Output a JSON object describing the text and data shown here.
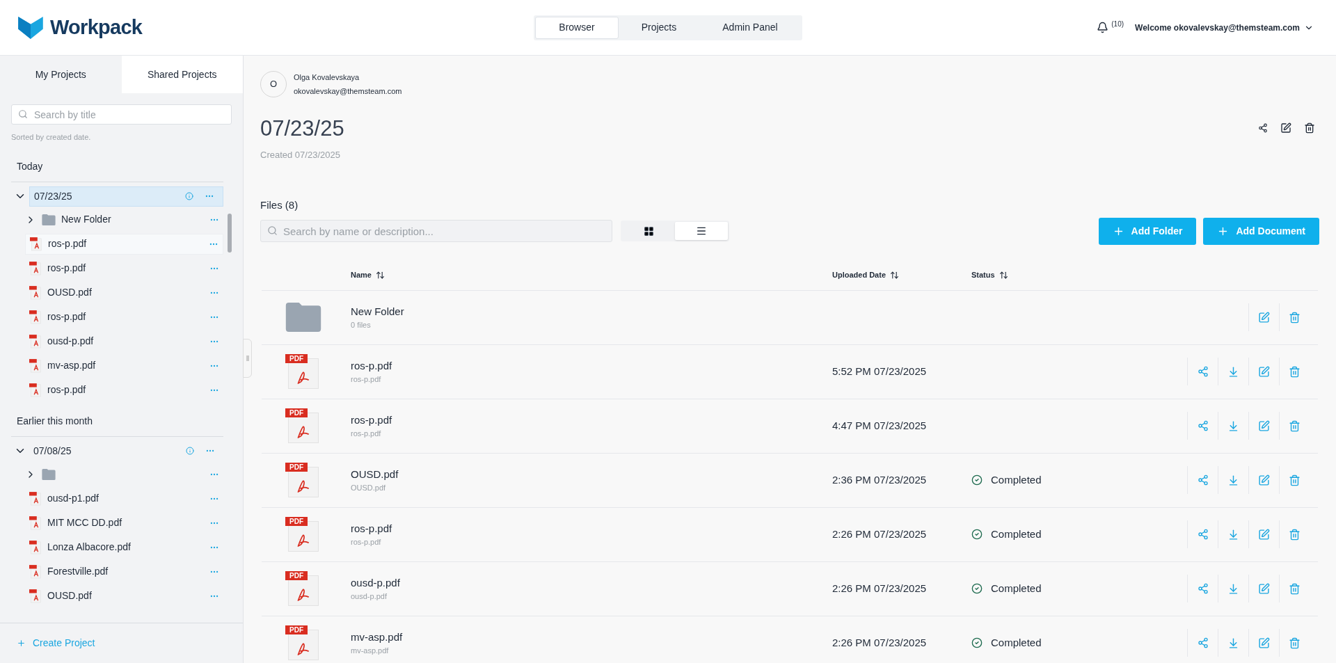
{
  "header": {
    "logo": "Workpack",
    "nav": [
      {
        "label": "Browser",
        "selected": true
      },
      {
        "label": "Projects",
        "selected": false
      },
      {
        "label": "Admin Panel",
        "selected": false
      }
    ],
    "notification_count": "(10)",
    "welcome": "Welcome okovalevskay@themsteam.com"
  },
  "sidebar": {
    "tabs": [
      {
        "label": "My Projects",
        "selected": false
      },
      {
        "label": "Shared Projects",
        "selected": true
      }
    ],
    "search": {
      "placeholder": "Search by title"
    },
    "sort_note": "Sorted by created date.",
    "sections": [
      {
        "label": "Today",
        "projects": [
          {
            "name": "07/23/25",
            "selected": true,
            "expanded": true,
            "children": [
              {
                "kind": "folder",
                "name": "New Folder",
                "expanded": false,
                "hovered": false
              },
              {
                "kind": "file",
                "name": "ros-p.pdf",
                "hovered": true
              },
              {
                "kind": "file",
                "name": "ros-p.pdf",
                "hovered": false
              },
              {
                "kind": "file",
                "name": "OUSD.pdf",
                "hovered": false
              },
              {
                "kind": "file",
                "name": "ros-p.pdf",
                "hovered": false
              },
              {
                "kind": "file",
                "name": "ousd-p.pdf",
                "hovered": false
              },
              {
                "kind": "file",
                "name": "mv-asp.pdf",
                "hovered": false
              },
              {
                "kind": "file",
                "name": "ros-p.pdf",
                "hovered": false
              }
            ]
          }
        ]
      },
      {
        "label": "Earlier this month",
        "projects": [
          {
            "name": "07/08/25",
            "selected": false,
            "expanded": true,
            "children": [
              {
                "kind": "folder",
                "expanded": false,
                "hovered": false
              },
              {
                "kind": "file",
                "name": "ousd-p1.pdf",
                "hovered": false
              },
              {
                "kind": "file",
                "name": "MIT MCC DD.pdf",
                "hovered": false
              },
              {
                "kind": "file",
                "name": "Lonza Albacore.pdf",
                "hovered": false
              },
              {
                "kind": "file",
                "name": "Forestville.pdf",
                "hovered": false
              },
              {
                "kind": "file",
                "name": "OUSD.pdf",
                "hovered": false
              }
            ]
          }
        ]
      }
    ],
    "create_project": "Create Project"
  },
  "main": {
    "owner": {
      "initial": "O",
      "name": "Olga Kovalevskaya",
      "email": "okovalevskay@themsteam.com"
    },
    "title": "07/23/25",
    "created": "Created 07/23/2025",
    "files_label": "Files (8)",
    "search": {
      "placeholder": "Search by name or description..."
    },
    "view_toggle": [
      {
        "kind": "grid",
        "selected": false
      },
      {
        "kind": "list",
        "selected": true
      }
    ],
    "buttons": [
      "Add Folder",
      "Add Document"
    ],
    "table": {
      "columns": [
        "Name",
        "Uploaded Date",
        "Status"
      ],
      "rows": [
        {
          "kind": "folder",
          "name": "New Folder",
          "subtitle": "0 files",
          "actions": {
            "share": false,
            "download": false,
            "edit": true,
            "delete": true
          }
        },
        {
          "kind": "file",
          "badge": "PDF",
          "name": "ros-p.pdf",
          "subtitle": "ros-p.pdf",
          "date": "5:52 PM 07/23/2025",
          "actions": {
            "share": true,
            "download": true,
            "edit": true,
            "delete": true
          }
        },
        {
          "kind": "file",
          "badge": "PDF",
          "name": "ros-p.pdf",
          "subtitle": "ros-p.pdf",
          "date": "4:47 PM 07/23/2025",
          "actions": {
            "share": true,
            "download": true,
            "edit": true,
            "delete": true
          }
        },
        {
          "kind": "file",
          "badge": "PDF",
          "name": "OUSD.pdf",
          "subtitle": "OUSD.pdf",
          "date": "2:36 PM 07/23/2025",
          "status": "Completed",
          "actions": {
            "share": true,
            "download": true,
            "edit": true,
            "delete": true
          }
        },
        {
          "kind": "file",
          "badge": "PDF",
          "name": "ros-p.pdf",
          "subtitle": "ros-p.pdf",
          "date": "2:26 PM 07/23/2025",
          "status": "Completed",
          "actions": {
            "share": true,
            "download": true,
            "edit": true,
            "delete": true
          }
        },
        {
          "kind": "file",
          "badge": "PDF",
          "name": "ousd-p.pdf",
          "subtitle": "ousd-p.pdf",
          "date": "2:26 PM 07/23/2025",
          "status": "Completed",
          "actions": {
            "share": true,
            "download": true,
            "edit": true,
            "delete": true
          }
        },
        {
          "kind": "file",
          "badge": "PDF",
          "name": "mv-asp.pdf",
          "subtitle": "mv-asp.pdf",
          "date": "2:26 PM 07/23/2025",
          "status": "Completed",
          "actions": {
            "share": true,
            "download": true,
            "edit": true,
            "delete": true
          }
        }
      ]
    }
  }
}
